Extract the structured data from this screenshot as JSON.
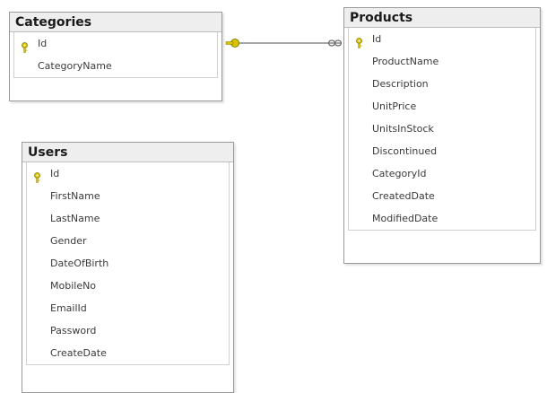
{
  "tables": {
    "categories": {
      "title": "Categories",
      "columns": [
        "Id",
        "CategoryName"
      ]
    },
    "products": {
      "title": "Products",
      "columns": [
        "Id",
        "ProductName",
        "Description",
        "UnitPrice",
        "UnitsInStock",
        "Discontinued",
        "CategoryId",
        "CreatedDate",
        "ModifiedDate"
      ]
    },
    "users": {
      "title": "Users",
      "columns": [
        "Id",
        "FirstName",
        "LastName",
        "Gender",
        "DateOfBirth",
        "MobileNo",
        "EmailId",
        "Password",
        "CreateDate"
      ]
    }
  },
  "relationship": {
    "from": "Categories",
    "to": "Products",
    "one_end_icon": "key-icon",
    "many_end_icon": "infinity-icon"
  }
}
